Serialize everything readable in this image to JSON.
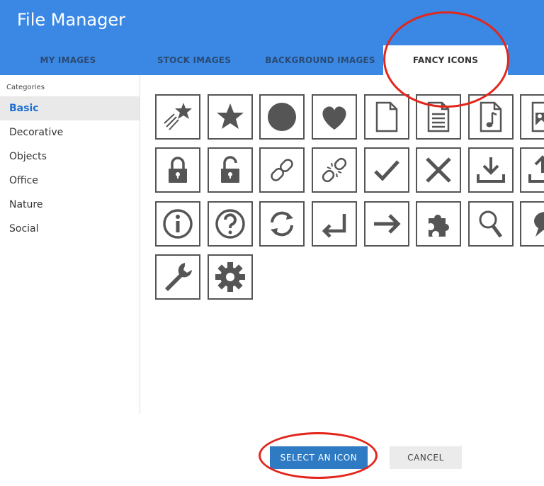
{
  "app": {
    "title": "File Manager"
  },
  "tabs": [
    {
      "label": "MY IMAGES",
      "active": false
    },
    {
      "label": "STOCK IMAGES",
      "active": false
    },
    {
      "label": "BACKGROUND IMAGES",
      "active": false
    },
    {
      "label": "FANCY ICONS",
      "active": true
    }
  ],
  "sidebar": {
    "heading": "Categories",
    "items": [
      {
        "label": "Basic",
        "active": true
      },
      {
        "label": "Decorative",
        "active": false
      },
      {
        "label": "Objects",
        "active": false
      },
      {
        "label": "Office",
        "active": false
      },
      {
        "label": "Nature",
        "active": false
      },
      {
        "label": "Social",
        "active": false
      }
    ]
  },
  "icons": [
    "shooting-star-icon",
    "star-icon",
    "circle-icon",
    "heart-icon",
    "document-icon",
    "document-lines-icon",
    "music-file-icon",
    "image-file-icon",
    "lock-closed-icon",
    "lock-open-icon",
    "link-icon",
    "broken-link-icon",
    "checkmark-icon",
    "x-mark-icon",
    "download-icon",
    "upload-icon",
    "info-icon",
    "question-icon",
    "refresh-icon",
    "return-arrow-icon",
    "right-arrow-icon",
    "puzzle-icon",
    "magnifier-icon",
    "speech-bubble-icon",
    "wrench-icon",
    "gear-icon"
  ],
  "buttons": {
    "select": "SELECT AN ICON",
    "cancel": "CANCEL"
  },
  "colors": {
    "header": "#3a88e4",
    "primary_button": "#2e7bc4",
    "annotation": "#e3261c",
    "icon": "#555555"
  }
}
